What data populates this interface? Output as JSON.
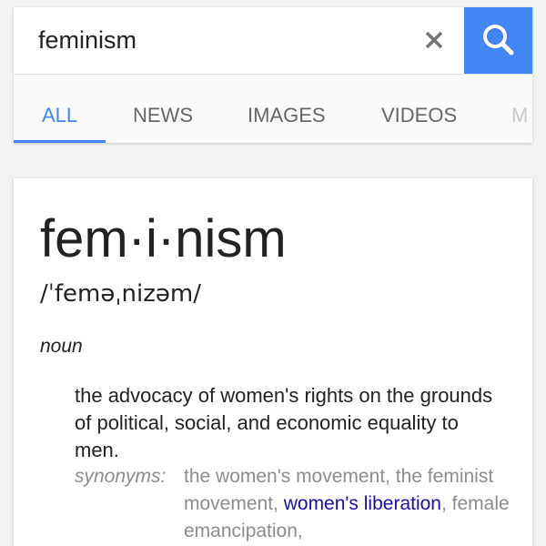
{
  "search": {
    "query": "feminism",
    "clear_icon": "close-icon",
    "search_icon": "search-icon",
    "accent_color": "#4285f4"
  },
  "tabs": [
    {
      "label": "ALL",
      "active": true
    },
    {
      "label": "NEWS",
      "active": false
    },
    {
      "label": "IMAGES",
      "active": false
    },
    {
      "label": "VIDEOS",
      "active": false
    },
    {
      "label": "M",
      "active": false
    }
  ],
  "definition": {
    "headword": "fem·i·nism",
    "pronunciation": "/ˈfeməˌnizəm/",
    "part_of_speech": "noun",
    "sense": "the advocacy of women's rights on the grounds of political, social, and economic equality to men.",
    "synonyms_label": "synonyms:",
    "synonyms": [
      {
        "text": "the women's movement",
        "link": false
      },
      {
        "text": "the feminist movement",
        "link": false
      },
      {
        "text": "women's liberation",
        "link": true
      },
      {
        "text": "female emancipation",
        "link": false
      }
    ],
    "link_color": "#1a0dab"
  }
}
